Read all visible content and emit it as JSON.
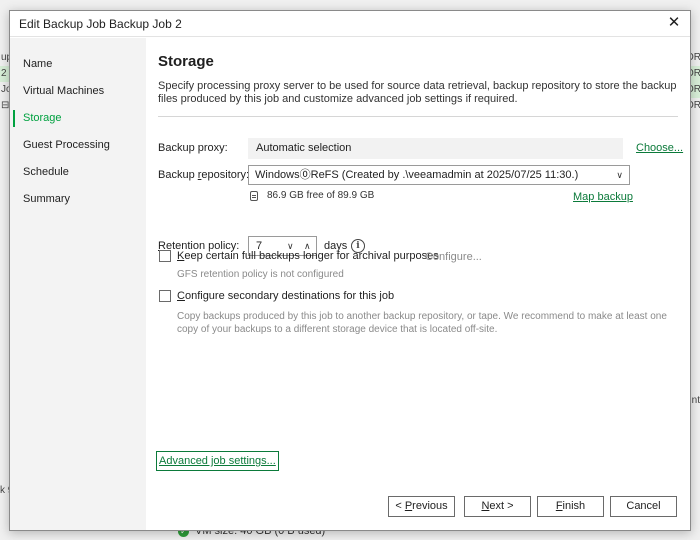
{
  "background": {
    "left_fragments": [
      "up",
      "2",
      "Jo",
      "⊟"
    ],
    "right_fragments": [
      "OR",
      "OR",
      "OR",
      "OR"
    ],
    "bottom_text": "VM size: 40 GB (0 B used)",
    "left_bottom_fragment": "k 9",
    "right_mid_fragment": "nt"
  },
  "dialog": {
    "title": "Edit Backup Job Backup Job 2",
    "close_symbol": "✕"
  },
  "sidebar": {
    "items": [
      {
        "label": "Name"
      },
      {
        "label": "Virtual Machines"
      },
      {
        "label": "Storage"
      },
      {
        "label": "Guest Processing"
      },
      {
        "label": "Schedule"
      },
      {
        "label": "Summary"
      }
    ],
    "active_index": 2
  },
  "header": {
    "title": "Storage",
    "description": "Specify processing proxy server to be used for source data retrieval, backup repository to store the backup files produced by this job and customize advanced job settings if required."
  },
  "form": {
    "proxy_label": "Backup proxy:",
    "proxy_value": "Automatic selection",
    "choose_link": "Choose...",
    "repo_label_pre": "Backup ",
    "repo_label_u": "r",
    "repo_label_post": "epository:",
    "repo_value": "Windows⓪ReFS (Created by .\\veeamadmin at 2025/07/25 11:30.)",
    "free_space": "86.9 GB free of 89.9 GB",
    "map_backup_u": "M",
    "map_backup_rest": "ap backup",
    "retention_label_u": "R",
    "retention_label_rest": "etention policy:",
    "retention_value": "7",
    "retention_unit": "days",
    "info_symbol": "i",
    "gfs": {
      "label_u": "K",
      "label_rest": "eep certain full backups longer for archival purposes",
      "configure": "Configure...",
      "status": "GFS retention policy is not configured",
      "checked": false
    },
    "secondary": {
      "label_u": "C",
      "label_rest": "onfigure secondary destinations for this job",
      "description": "Copy backups produced by this job to another backup repository, or tape. We recommend to make at least one copy of your backups to a different storage device that is located off-site.",
      "checked": false
    }
  },
  "advanced_link": "Advanced job settings...",
  "buttons": {
    "previous": {
      "pre": "< ",
      "u": "P",
      "post": "revious"
    },
    "next": {
      "u": "N",
      "post": "ext >"
    },
    "finish": {
      "u": "F",
      "post": "inish"
    },
    "cancel": "Cancel"
  },
  "colors": {
    "accent": "#00a140",
    "link": "#0b7a3a",
    "muted_text": "#8a8a8a"
  }
}
